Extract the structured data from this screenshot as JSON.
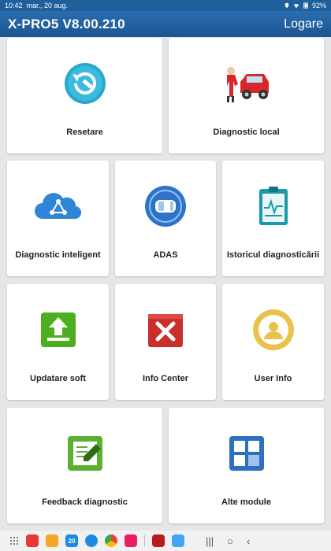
{
  "status": {
    "time": "10:42",
    "date": "mar., 20 aug.",
    "battery": "92%"
  },
  "app": {
    "title": "X-PRO5 V8.00.210",
    "logout": "Logare"
  },
  "tiles": [
    {
      "label": "Resetare",
      "icon": "reset-wrench-icon"
    },
    {
      "label": "Diagnostic local",
      "icon": "mechanic-car-icon"
    },
    {
      "label": "Diagnostic inteligent",
      "icon": "cloud-network-icon"
    },
    {
      "label": "ADAS",
      "icon": "adas-car-sensor-icon"
    },
    {
      "label": "Istoricul diagnosticării",
      "icon": "history-clipboard-icon"
    },
    {
      "label": "Updatare soft",
      "icon": "upload-icon"
    },
    {
      "label": "Info Center",
      "icon": "tools-book-icon"
    },
    {
      "label": "User Info",
      "icon": "user-profile-icon"
    },
    {
      "label": "Feedback diagnostic",
      "icon": "feedback-pencil-icon"
    },
    {
      "label": "Alte module",
      "icon": "modules-grid-icon"
    }
  ],
  "colors": {
    "appbar": "#1f5f9c",
    "reset": "#2aa6c9",
    "cloud": "#2f86d6",
    "upload": "#4caf1f",
    "tools": "#c9302c",
    "user": "#e8c24a",
    "feedback": "#5cb030",
    "modules": "#2f6fbf"
  }
}
